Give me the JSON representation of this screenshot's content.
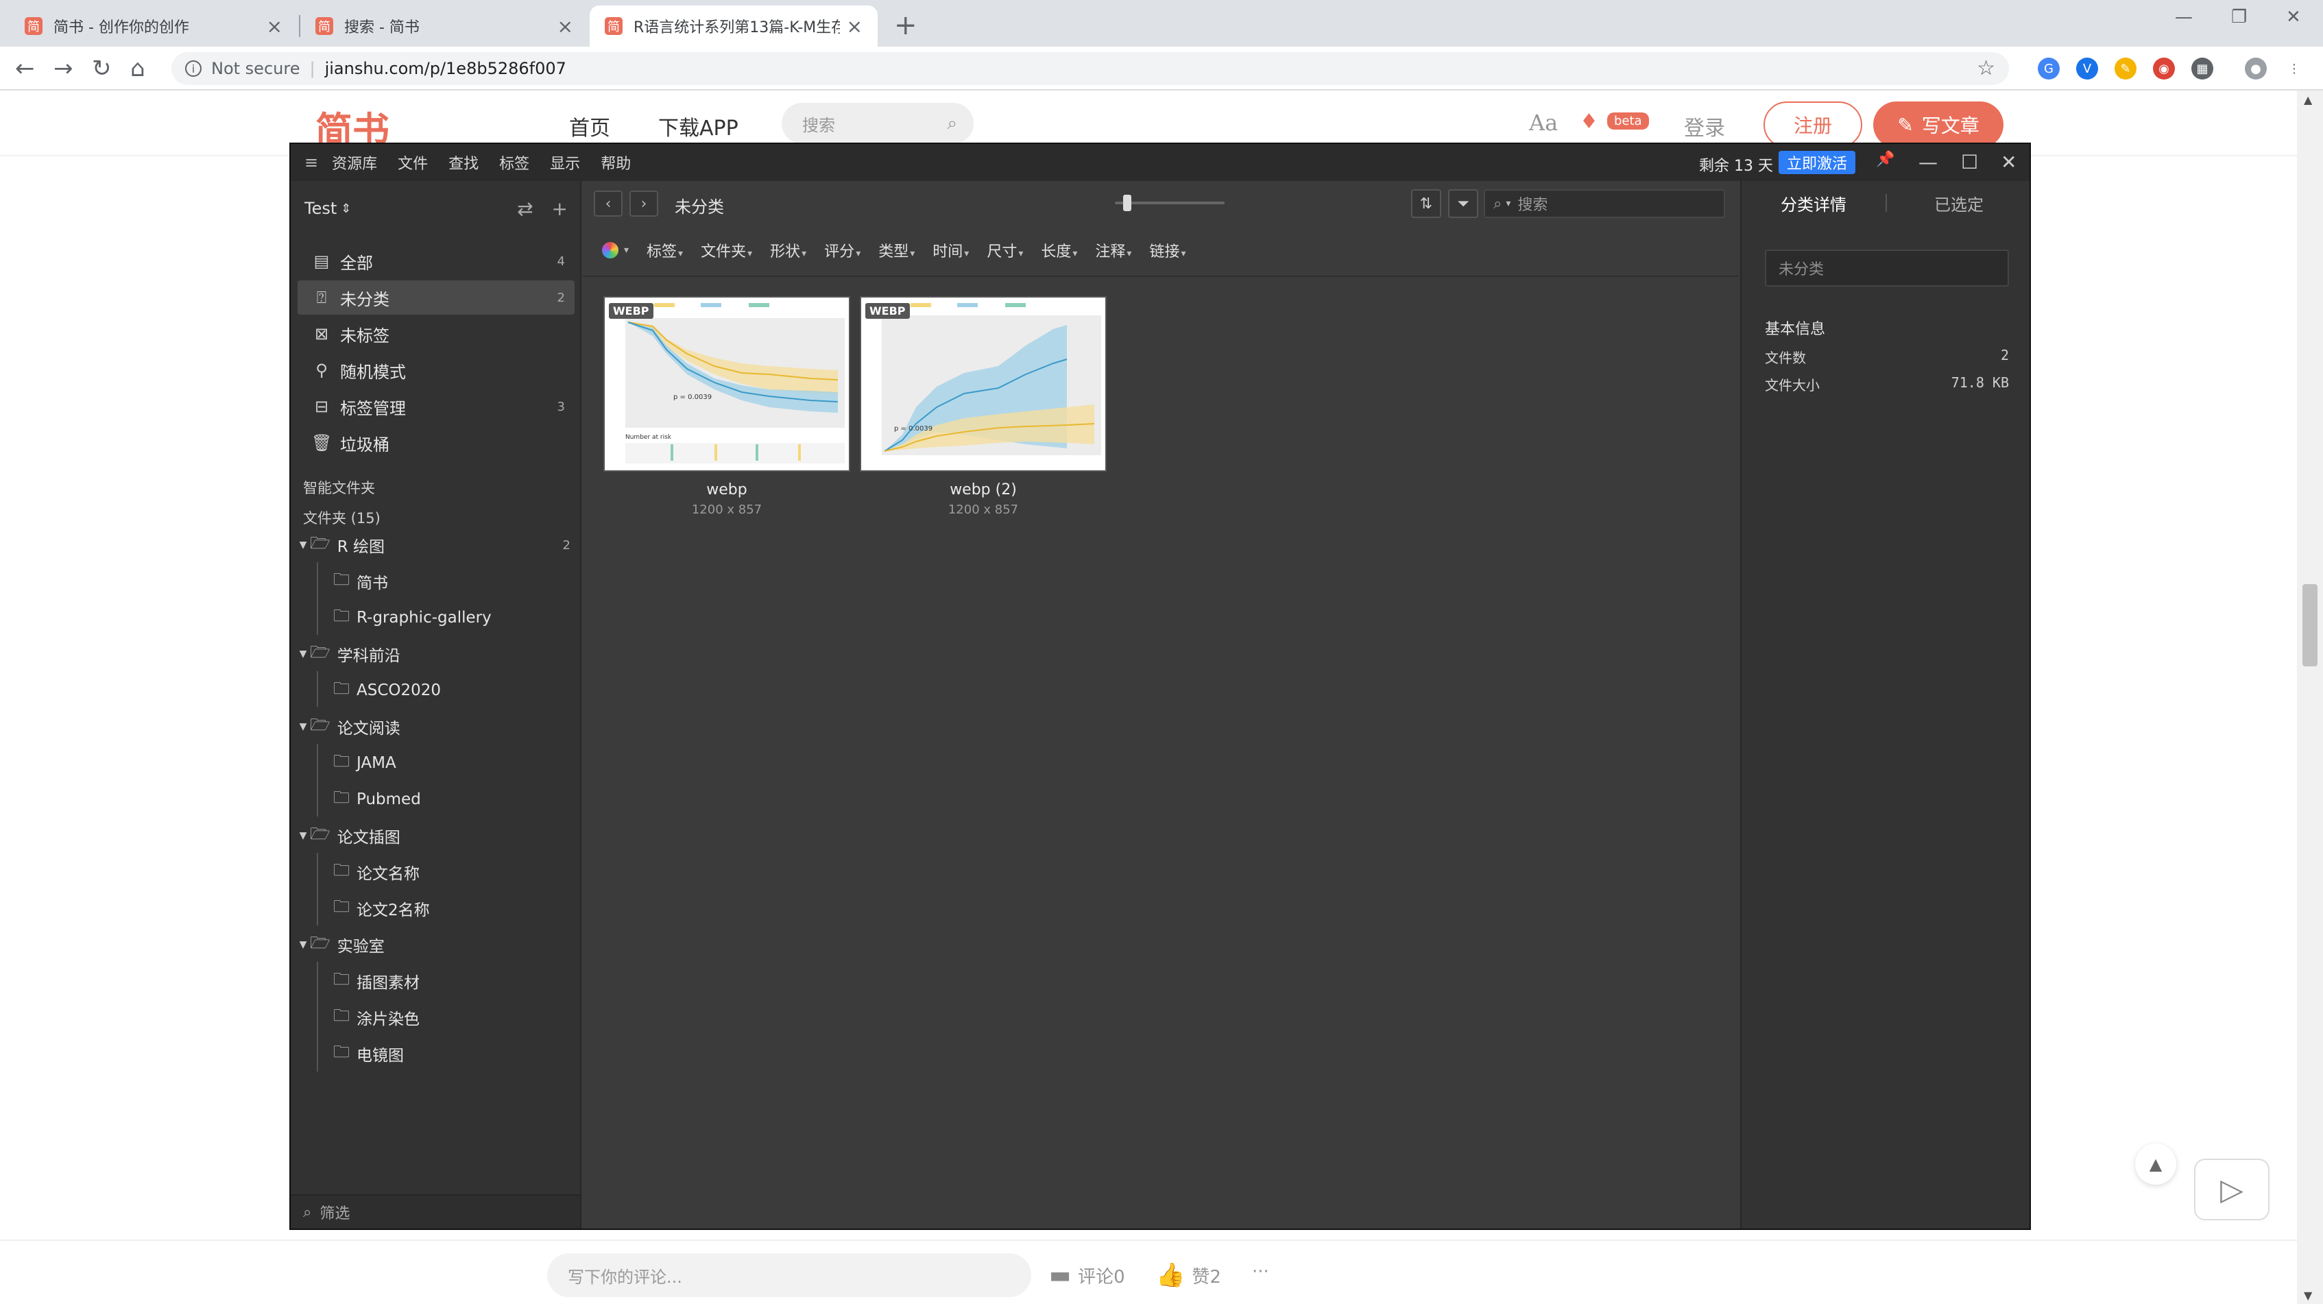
{
  "browser": {
    "tabs": [
      {
        "title": "简书 - 创作你的创作",
        "favicon": "简"
      },
      {
        "title": "搜索 - 简书",
        "favicon": "简"
      },
      {
        "title": "R语言统计系列第13篇-K-M生存分",
        "favicon": "简"
      }
    ],
    "new_tab": "+",
    "security": "Not secure",
    "url": "jianshu.com/p/1e8b5286f007"
  },
  "jianshu": {
    "logo": "简书",
    "nav": [
      "首页",
      "下载APP"
    ],
    "search_placeholder": "搜索",
    "aa": "Aa",
    "beta": "beta",
    "login": "登录",
    "register": "注册",
    "write": "写文章",
    "comment_placeholder": "写下你的评论...",
    "comment_count": "评论0",
    "like_count": "赞2",
    "more": "···"
  },
  "eagle": {
    "menu": [
      "资源库",
      "文件",
      "查找",
      "标签",
      "显示",
      "帮助"
    ],
    "trial_text": "剩余 13 天",
    "activate": "立即激活",
    "library": "Test",
    "sidebar_items": [
      {
        "label": "全部",
        "count": "4",
        "icon": "all-icon"
      },
      {
        "label": "未分类",
        "count": "2",
        "icon": "uncategorized-icon"
      },
      {
        "label": "未标签",
        "count": "",
        "icon": "untagged-icon"
      },
      {
        "label": "随机模式",
        "count": "",
        "icon": "random-icon"
      },
      {
        "label": "标签管理",
        "count": "3",
        "icon": "tag-manage-icon"
      },
      {
        "label": "垃圾桶",
        "count": "",
        "icon": "trash-icon"
      }
    ],
    "smart_folders": "智能文件夹",
    "folders_header": "文件夹 (15)",
    "folders": [
      {
        "label": "R 绘图",
        "count": "2",
        "children": [
          "简书",
          "R-graphic-gallery"
        ]
      },
      {
        "label": "学科前沿",
        "count": "",
        "children": [
          "ASCO2020"
        ]
      },
      {
        "label": "论文阅读",
        "count": "",
        "children": [
          "JAMA",
          "Pubmed"
        ]
      },
      {
        "label": "论文插图",
        "count": "",
        "children": [
          "论文名称",
          "论文2名称"
        ]
      },
      {
        "label": "实验室",
        "count": "",
        "children": [
          "插图素材",
          "涂片染色",
          "电镜图"
        ]
      }
    ],
    "filter_placeholder": "筛选",
    "breadcrumb": "未分类",
    "search_placeholder": "搜索",
    "filters": [
      "标签",
      "文件夹",
      "形状",
      "评分",
      "类型",
      "时间",
      "尺寸",
      "长度",
      "注释",
      "链接"
    ],
    "thumbnails": [
      {
        "name": "webp",
        "dims": "1200 x 857",
        "badge": "WEBP",
        "pvalue": "p = 0.0039",
        "risk_label": "Number at risk"
      },
      {
        "name": "webp (2)",
        "dims": "1200 x 857",
        "badge": "WEBP",
        "pvalue": "p = 0.0039",
        "risk_label": ""
      }
    ],
    "right_tabs": [
      "分类详情",
      "已选定"
    ],
    "category_name": "未分类",
    "info_header": "基本信息",
    "info_rows": [
      {
        "label": "文件数",
        "value": "2"
      },
      {
        "label": "文件大小",
        "value": "71.8 KB"
      }
    ]
  }
}
